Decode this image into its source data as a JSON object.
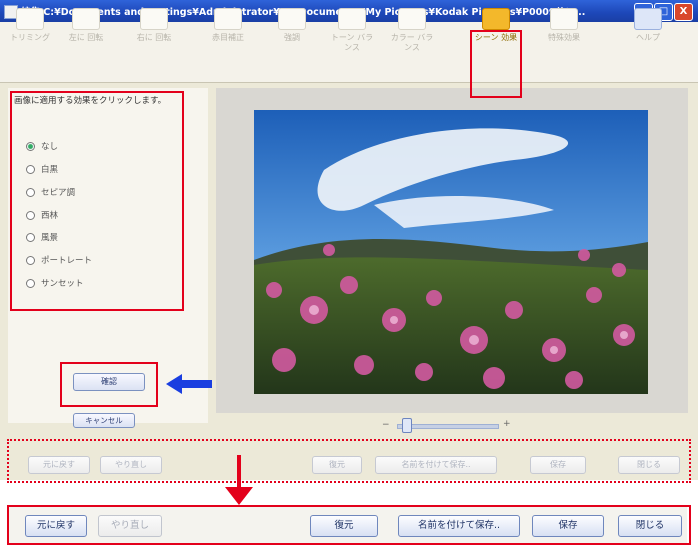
{
  "window": {
    "title": "編集 C:¥Documents and Settings¥Administrator¥My Documents¥My Pictures¥Kodak Pictures¥P0009サン...",
    "minimize": "_",
    "maximize": "□",
    "close": "X"
  },
  "toolbar": {
    "tools": [
      {
        "label": "トリミング",
        "active": false
      },
      {
        "label": "左に 回転",
        "active": false
      },
      {
        "label": "右に 回転",
        "active": false
      },
      {
        "label": "赤目補正",
        "active": false
      },
      {
        "label": "強調",
        "active": false
      },
      {
        "label": "トーン バランス",
        "active": false
      },
      {
        "label": "カラー バランス",
        "active": false
      },
      {
        "label": "シーン 効果",
        "active": true
      },
      {
        "label": "特殊効果",
        "active": false
      },
      {
        "label": "ヘルプ",
        "active": false
      }
    ]
  },
  "effects_panel": {
    "instruction": "画像に適用する効果をクリックします。",
    "options": [
      {
        "label": "なし",
        "selected": true
      },
      {
        "label": "白黒",
        "selected": false
      },
      {
        "label": "セピア調",
        "selected": false
      },
      {
        "label": "西林",
        "selected": false
      },
      {
        "label": "風景",
        "selected": false
      },
      {
        "label": "ポートレート",
        "selected": false
      },
      {
        "label": "サンセット",
        "selected": false
      }
    ],
    "confirm_label": "確認",
    "cancel_label": "キャンセル"
  },
  "viewer": {
    "zoom_minus": "−",
    "zoom_plus": "+",
    "zoom_level": 0.05
  },
  "bottom_bar": {
    "undo": "元に戻す",
    "redo": "やり直し",
    "restore": "復元",
    "save_as": "名前を付けて保存..",
    "save": "保存",
    "close": "閉じる"
  },
  "zoomed_bar": {
    "undo": "元に戻す",
    "redo": "やり直し",
    "restore": "復元",
    "save_as": "名前を付けて保存..",
    "save": "保存",
    "close": "閉じる"
  },
  "colors": {
    "annotation": "#e3001b",
    "arrow": "#1a3ee0",
    "title_bar": "#2f63d9",
    "active_tool": "#f3b82b"
  }
}
